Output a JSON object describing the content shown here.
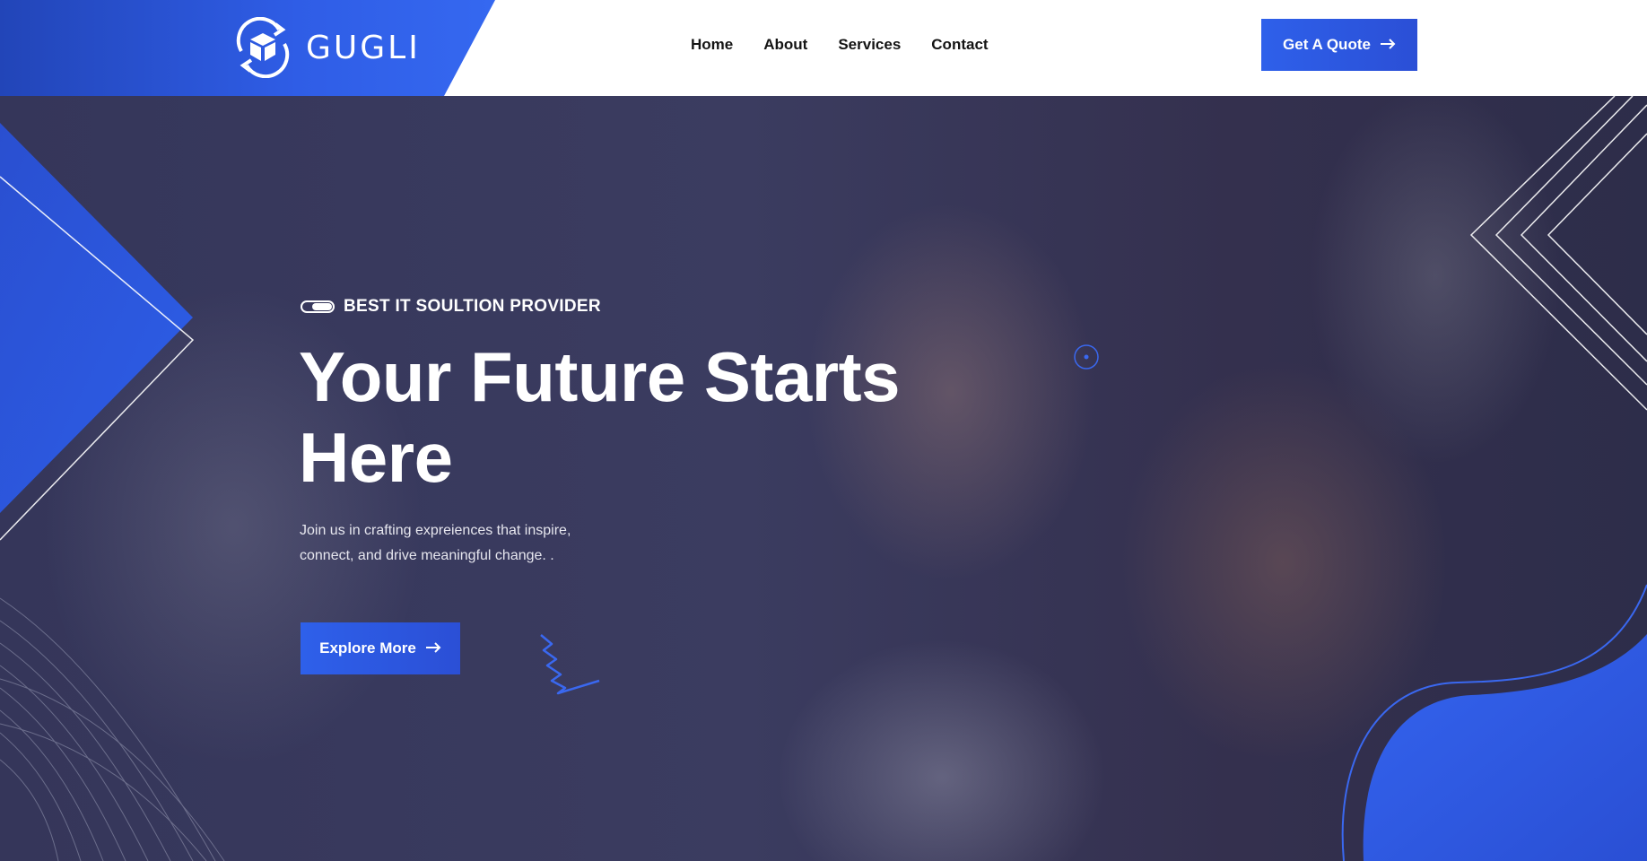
{
  "header": {
    "logo_text": "GUGLI",
    "nav": [
      "Home",
      "About",
      "Services",
      "Contact"
    ],
    "cta_label": "Get A Quote"
  },
  "hero": {
    "tagline": "BEST IT SOULTION PROVIDER",
    "headline_line1": "Your Future Starts",
    "headline_line2": "Here",
    "subtext_line1": "Join us in crafting expreiences that inspire,",
    "subtext_line2": "connect, and drive meaningful change. .",
    "button_label": "Explore More"
  },
  "colors": {
    "accent": "#2e60ea",
    "header_bg": "#ffffff",
    "overlay": "#35365a"
  },
  "icons": {
    "logo": "cube-cycle-icon",
    "arrow": "arrow-right-icon",
    "squiggle": "squiggle-decoration",
    "target": "target-dot-icon"
  }
}
